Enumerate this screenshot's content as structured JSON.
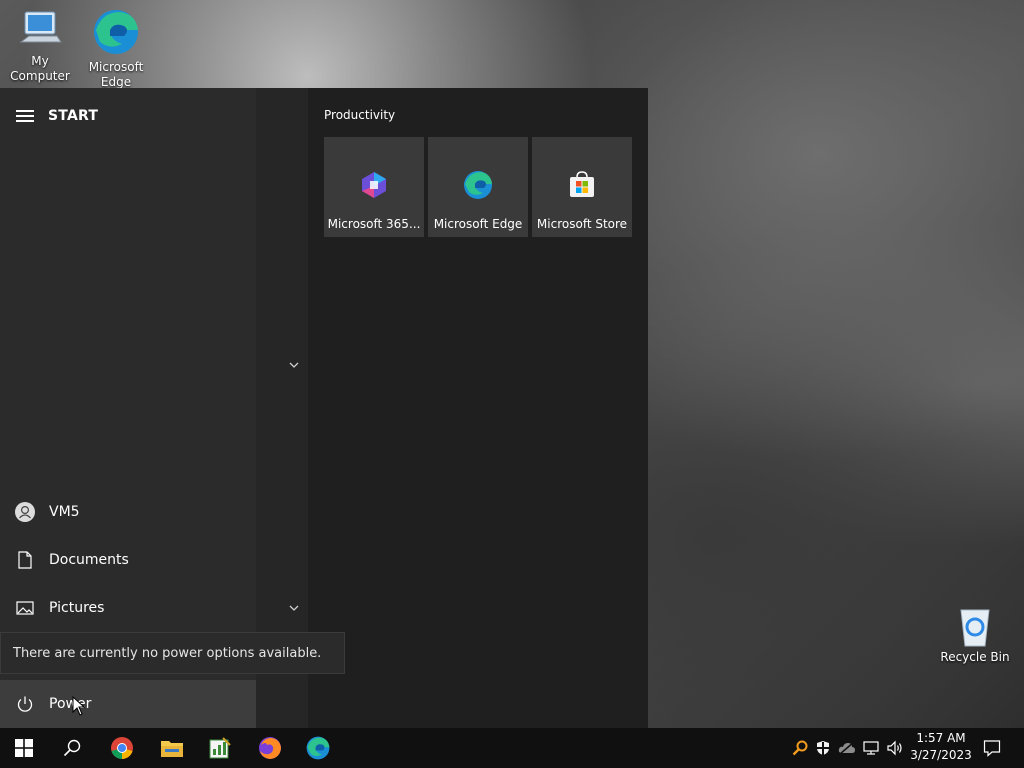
{
  "desktop": {
    "icons": [
      {
        "label": "My Computer",
        "icon": "computer-icon"
      },
      {
        "label": "Microsoft Edge",
        "icon": "edge-icon"
      },
      {
        "label": "Recycle Bin",
        "icon": "recycle-bin-icon"
      }
    ]
  },
  "start_menu": {
    "title": "START",
    "left_items": [
      {
        "label": "VM5",
        "icon": "user-icon"
      },
      {
        "label": "Documents",
        "icon": "document-icon"
      },
      {
        "label": "Pictures",
        "icon": "pictures-icon"
      }
    ],
    "power": {
      "label": "Power",
      "icon": "power-icon"
    },
    "tooltip": "There are currently no power options available.",
    "group": {
      "title": "Productivity",
      "tiles": [
        {
          "label": "Microsoft 365...",
          "icon": "m365-icon"
        },
        {
          "label": "Microsoft Edge",
          "icon": "edge-icon"
        },
        {
          "label": "Microsoft Store",
          "icon": "store-icon"
        }
      ]
    }
  },
  "taskbar": {
    "apps": [
      "start-icon",
      "search-icon",
      "chrome-icon",
      "file-explorer-icon",
      "spreadsheet-icon",
      "firefox-icon",
      "edge-icon"
    ],
    "tray": [
      "search-tray-icon",
      "security-icon",
      "cloud-icon",
      "network-icon",
      "volume-icon"
    ],
    "clock": {
      "time": "1:57 AM",
      "date": "3/27/2023"
    }
  },
  "colors": {
    "start_bg": "#1f1f1f",
    "left_bg": "#2b2b2b",
    "tile_bg": "#3a3a3a",
    "taskbar_bg": "#101010"
  }
}
